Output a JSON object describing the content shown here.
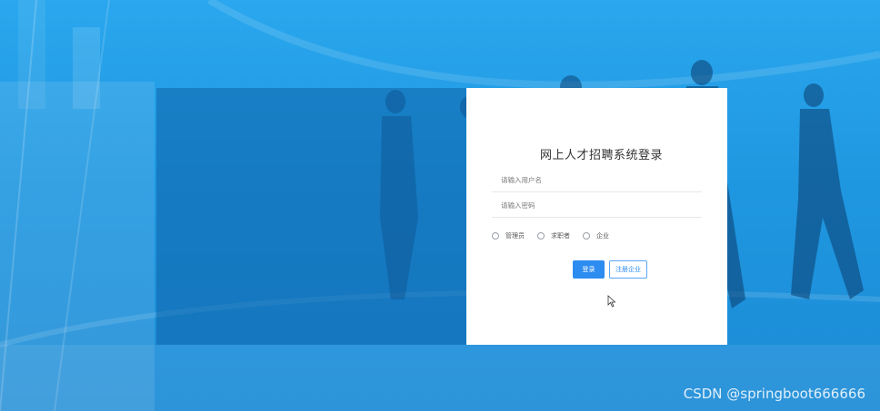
{
  "login": {
    "title": "网上人才招聘系统登录",
    "username_placeholder": "请输入用户名",
    "password_placeholder": "请输入密码",
    "roles": [
      {
        "label": "管理员"
      },
      {
        "label": "求职者"
      },
      {
        "label": "企业"
      }
    ],
    "login_button": "登录",
    "register_button": "注册企业"
  },
  "watermark": "CSDN @springboot666666",
  "colors": {
    "background": "#1f97e0",
    "primary": "#2d8cf0",
    "card": "#ffffff"
  }
}
